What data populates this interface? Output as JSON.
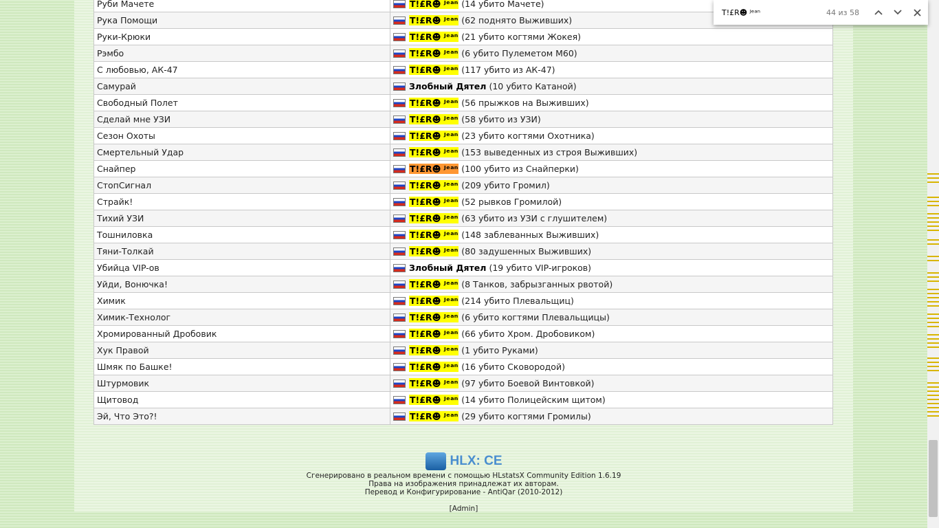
{
  "awards": {
    "rows": [
      {
        "award": "Руби Мачете",
        "player": "T!£R☻ ᴶᵉᵃⁿ",
        "detail": "(14 убито Мачете)",
        "hl": "yes"
      },
      {
        "award": "Рука Помощи",
        "player": "T!£R☻ ᴶᵉᵃⁿ",
        "detail": "(62 поднято Выживших)",
        "hl": "yes"
      },
      {
        "award": "Руки-Крюки",
        "player": "T!£R☻ ᴶᵉᵃⁿ",
        "detail": "(21 убито когтями Жокея)",
        "hl": "yes"
      },
      {
        "award": "Рэмбо",
        "player": "T!£R☻ ᴶᵉᵃⁿ",
        "detail": "(6 убито Пулеметом M60)",
        "hl": "yes"
      },
      {
        "award": "С любовью, АК-47",
        "player": "T!£R☻ ᴶᵉᵃⁿ",
        "detail": "(117 убито из АК-47)",
        "hl": "yes"
      },
      {
        "award": "Самурай",
        "player": "Злобный Дятел",
        "detail": "(10 убито Катаной)",
        "hl": "no"
      },
      {
        "award": "Свободный Полет",
        "player": "T!£R☻ ᴶᵉᵃⁿ",
        "detail": "(56 прыжков на Выживших)",
        "hl": "yes"
      },
      {
        "award": "Сделай мне УЗИ",
        "player": "T!£R☻ ᴶᵉᵃⁿ",
        "detail": "(58 убито из УЗИ)",
        "hl": "yes"
      },
      {
        "award": "Сезон Охоты",
        "player": "T!£R☻ ᴶᵉᵃⁿ",
        "detail": "(23 убито когтями Охотника)",
        "hl": "yes"
      },
      {
        "award": "Смертельный Удар",
        "player": "T!£R☻ ᴶᵉᵃⁿ",
        "detail": "(153 выведенных из строя Выживших)",
        "hl": "yes"
      },
      {
        "award": "Снайпер",
        "player": "T!£R☻ ᴶᵉᵃⁿ",
        "detail": "(100 убито из Снайперки)",
        "hl": "current"
      },
      {
        "award": "СтопСигнал",
        "player": "T!£R☻ ᴶᵉᵃⁿ",
        "detail": "(209 убито Громил)",
        "hl": "yes"
      },
      {
        "award": "Страйк!",
        "player": "T!£R☻ ᴶᵉᵃⁿ",
        "detail": "(52 рывков Громилой)",
        "hl": "yes"
      },
      {
        "award": "Тихий УЗИ",
        "player": "T!£R☻ ᴶᵉᵃⁿ",
        "detail": "(63 убито из УЗИ с глушителем)",
        "hl": "yes"
      },
      {
        "award": "Тошниловка",
        "player": "T!£R☻ ᴶᵉᵃⁿ",
        "detail": "(148 заблеванных Выживших)",
        "hl": "yes"
      },
      {
        "award": "Тяни-Толкай",
        "player": "T!£R☻ ᴶᵉᵃⁿ",
        "detail": "(80 задушенных Выживших)",
        "hl": "yes"
      },
      {
        "award": "Убийца VIP-ов",
        "player": "Злобный Дятел",
        "detail": "(19 убито VIP-игроков)",
        "hl": "no"
      },
      {
        "award": "Уйди, Вонючка!",
        "player": "T!£R☻ ᴶᵉᵃⁿ",
        "detail": "(8 Танков, забрызганных рвотой)",
        "hl": "yes"
      },
      {
        "award": "Химик",
        "player": "T!£R☻ ᴶᵉᵃⁿ",
        "detail": "(214 убито Плевальщиц)",
        "hl": "yes"
      },
      {
        "award": "Химик-Технолог",
        "player": "T!£R☻ ᴶᵉᵃⁿ",
        "detail": "(6 убито когтями Плевальщицы)",
        "hl": "yes"
      },
      {
        "award": "Хромированный Дробовик",
        "player": "T!£R☻ ᴶᵉᵃⁿ",
        "detail": "(66 убито Хром. Дробовиком)",
        "hl": "yes"
      },
      {
        "award": "Хук Правой",
        "player": "T!£R☻ ᴶᵉᵃⁿ",
        "detail": "(1 убито Руками)",
        "hl": "yes"
      },
      {
        "award": "Шмяк по Башке!",
        "player": "T!£R☻ ᴶᵉᵃⁿ",
        "detail": "(16 убито Сковородой)",
        "hl": "yes"
      },
      {
        "award": "Штурмовик",
        "player": "T!£R☻ ᴶᵉᵃⁿ",
        "detail": "(97 убито Боевой Винтовкой)",
        "hl": "yes"
      },
      {
        "award": "Щитовод",
        "player": "T!£R☻ ᴶᵉᵃⁿ",
        "detail": "(14 убито Полицейским щитом)",
        "hl": "yes"
      },
      {
        "award": "Эй, Что Это?!",
        "player": "T!£R☻ ᴶᵉᵃⁿ",
        "detail": "(29 убито когтями Громилы)",
        "hl": "yes"
      }
    ]
  },
  "footer": {
    "logo_text": "HLX: CE",
    "line1": "Сгенерировано в реальном времени с помощью HLstatsX Community Edition 1.6.19",
    "line2": "Права на изображения принадлежат их авторам.",
    "line3": "Перевод и Конфигурирование - AntiQar (2010-2012)",
    "admin_link": "[Admin]"
  },
  "findbar": {
    "query": "T!£R☻ ᴶᵉᵃⁿ",
    "count": "44 из 58",
    "prev_icon": "chevron-up-icon",
    "next_icon": "chevron-down-icon",
    "close_icon": "close-icon"
  },
  "colors": {
    "highlight": "#ffff00",
    "current_highlight": "#ff9632",
    "background": "#d5ecc6"
  }
}
